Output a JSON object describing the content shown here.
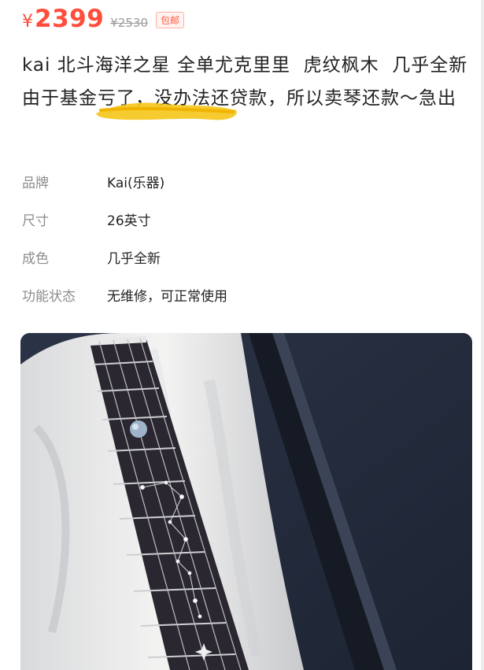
{
  "listing": {
    "currency": "¥",
    "price": "2399",
    "original_price": "¥2530",
    "shipping_badge": "包邮",
    "description": "kai 北斗海洋之星 全单尤克里里  虎纹枫木  几乎全新   由于基金亏了，没办法还贷款，所以卖琴还款～急出",
    "attributes": [
      {
        "key": "品牌",
        "value": "Kai(乐器)"
      },
      {
        "key": "尺寸",
        "value": "26英寸"
      },
      {
        "key": "成色",
        "value": "几乎全新"
      },
      {
        "key": "功能状态",
        "value": "无维修，可正常使用"
      }
    ]
  },
  "colors": {
    "price": "#ff4d3b",
    "scribble": "#f5c518"
  },
  "photo": {
    "alt": "ukulele-fretboard-in-case"
  }
}
